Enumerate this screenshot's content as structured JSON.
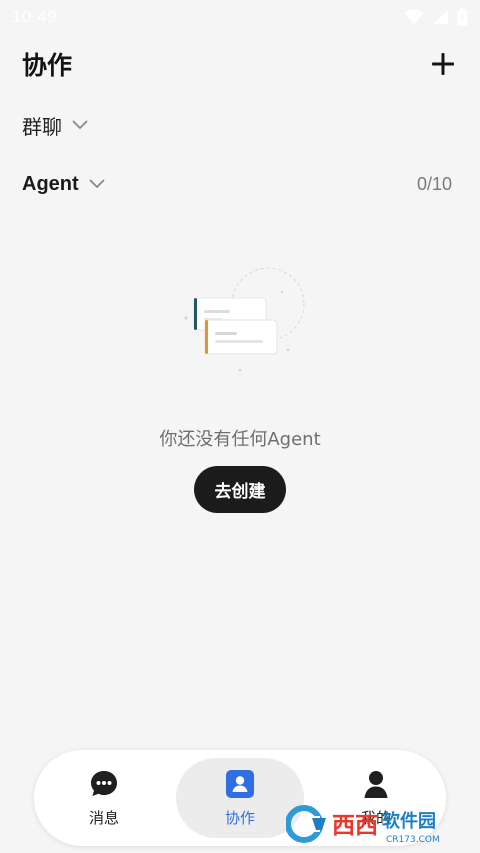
{
  "status_bar": {
    "time": "10:49"
  },
  "header": {
    "title": "协作",
    "add_icon": "plus-icon"
  },
  "group_section": {
    "label": "群聊",
    "icon": "chevron-down-icon"
  },
  "agent_section": {
    "label": "Agent",
    "count": "0/10",
    "icon": "chevron-down-icon"
  },
  "empty_state": {
    "message": "你还没有任何Agent",
    "button_label": "去创建",
    "illustration": "message-cards-illustration"
  },
  "bottom_nav": {
    "items": [
      {
        "label": "消息",
        "icon": "chat-bubble-icon"
      },
      {
        "label": "协作",
        "icon": "contact-card-icon",
        "active": true
      },
      {
        "label": "我的",
        "icon": "person-icon"
      }
    ]
  },
  "watermark": {
    "text": "西西软件园",
    "subtext": "CR173.COM"
  },
  "colors": {
    "accent": "#2f6fe4",
    "button_bg": "#1c1c1c",
    "background": "#f5f5f5"
  }
}
